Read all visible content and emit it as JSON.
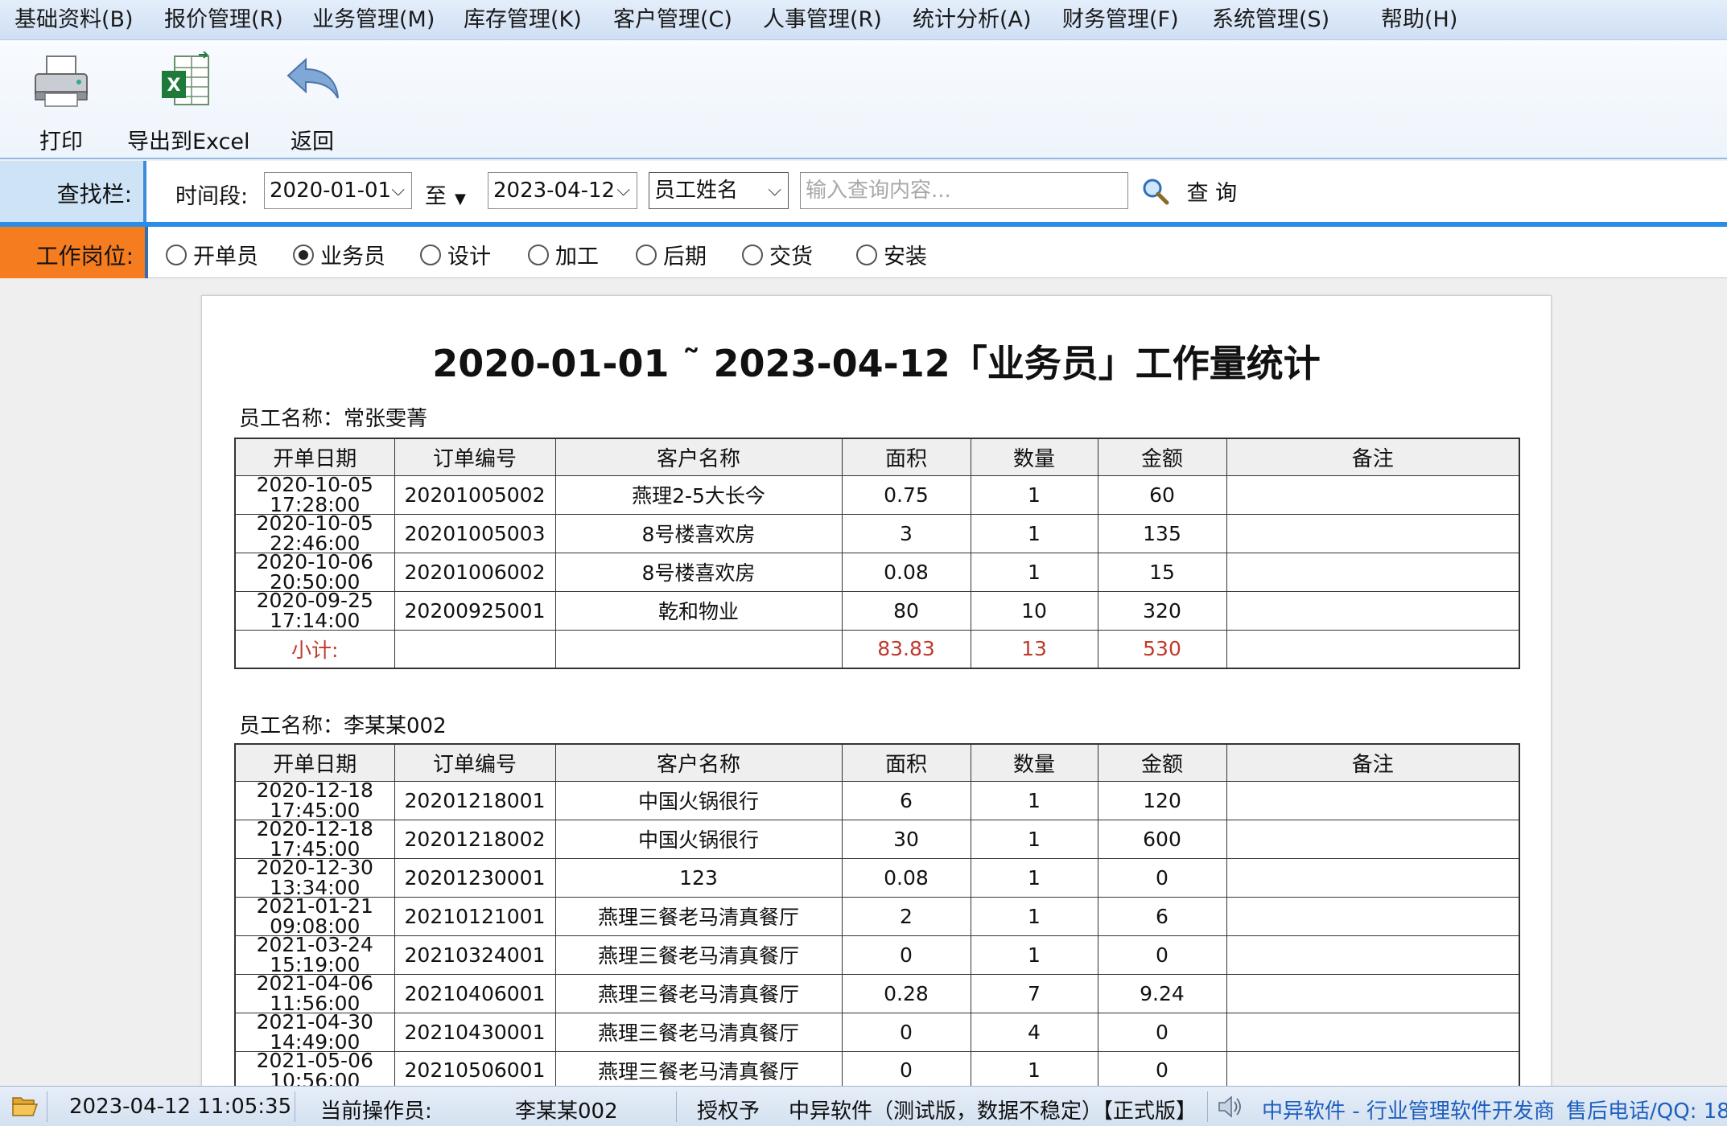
{
  "menu": [
    "基础资料(B)",
    "报价管理(R)",
    "业务管理(M)",
    "库存管理(K)",
    "客户管理(C)",
    "人事管理(R)",
    "统计分析(A)",
    "财务管理(F)",
    "系统管理(S)",
    "帮助(H)"
  ],
  "toolbar": {
    "print_label": "打印",
    "print_icon": "printer-icon",
    "export_label": "导出到Excel",
    "export_icon": "excel-export-icon",
    "back_label": "返回",
    "back_icon": "undo-arrow-icon"
  },
  "search": {
    "bar_label": "查找栏:",
    "period_label": "时间段:",
    "date_from": "2020-01-01",
    "to_label": "至",
    "date_to": "2023-04-12",
    "field_select": "员工姓名",
    "query_placeholder": "输入查询内容...",
    "query_label": "查 询"
  },
  "positions": {
    "label": "工作岗位:",
    "options": [
      "开单员",
      "业务员",
      "设计",
      "加工",
      "后期",
      "交货",
      "安装"
    ],
    "selected": "业务员"
  },
  "report": {
    "title": "2020-01-01 ˜ 2023-04-12「业务员」工作量统计",
    "columns": [
      "开单日期",
      "订单编号",
      "客户名称",
      "面积",
      "数量",
      "金额",
      "备注"
    ],
    "groups": [
      {
        "employee_label": "员工名称：常张雯菁",
        "rows": [
          {
            "date": "2020-10-05",
            "time": "17:28:00",
            "order": "20201005002",
            "customer": "燕理2-5大长今",
            "area": "0.75",
            "qty": "1",
            "amount": "60",
            "note": ""
          },
          {
            "date": "2020-10-05",
            "time": "22:46:00",
            "order": "20201005003",
            "customer": "8号楼喜欢房",
            "area": "3",
            "qty": "1",
            "amount": "135",
            "note": ""
          },
          {
            "date": "2020-10-06",
            "time": "20:50:00",
            "order": "20201006002",
            "customer": "8号楼喜欢房",
            "area": "0.08",
            "qty": "1",
            "amount": "15",
            "note": ""
          },
          {
            "date": "2020-09-25",
            "time": "17:14:00",
            "order": "20200925001",
            "customer": "乾和物业",
            "area": "80",
            "qty": "10",
            "amount": "320",
            "note": ""
          }
        ],
        "subtotal": {
          "label": "小计:",
          "area": "83.83",
          "qty": "13",
          "amount": "530"
        }
      },
      {
        "employee_label": "员工名称：李某某002",
        "rows": [
          {
            "date": "2020-12-18",
            "time": "17:45:00",
            "order": "20201218001",
            "customer": "中国火锅很行",
            "area": "6",
            "qty": "1",
            "amount": "120",
            "note": ""
          },
          {
            "date": "2020-12-18",
            "time": "17:45:00",
            "order": "20201218002",
            "customer": "中国火锅很行",
            "area": "30",
            "qty": "1",
            "amount": "600",
            "note": ""
          },
          {
            "date": "2020-12-30",
            "time": "13:34:00",
            "order": "20201230001",
            "customer": "123",
            "area": "0.08",
            "qty": "1",
            "amount": "0",
            "note": ""
          },
          {
            "date": "2021-01-21",
            "time": "09:08:00",
            "order": "20210121001",
            "customer": "燕理三餐老马清真餐厅",
            "area": "2",
            "qty": "1",
            "amount": "6",
            "note": ""
          },
          {
            "date": "2021-03-24",
            "time": "15:19:00",
            "order": "20210324001",
            "customer": "燕理三餐老马清真餐厅",
            "area": "0",
            "qty": "1",
            "amount": "0",
            "note": ""
          },
          {
            "date": "2021-04-06",
            "time": "11:56:00",
            "order": "20210406001",
            "customer": "燕理三餐老马清真餐厅",
            "area": "0.28",
            "qty": "7",
            "amount": "9.24",
            "note": ""
          },
          {
            "date": "2021-04-30",
            "time": "14:49:00",
            "order": "20210430001",
            "customer": "燕理三餐老马清真餐厅",
            "area": "0",
            "qty": "4",
            "amount": "0",
            "note": ""
          },
          {
            "date": "2021-05-06",
            "time": "10:56:00",
            "order": "20210506001",
            "customer": "燕理三餐老马清真餐厅",
            "area": "0",
            "qty": "1",
            "amount": "0",
            "note": ""
          }
        ]
      }
    ]
  },
  "status": {
    "folder_icon": "folder-open-icon",
    "datetime": "2023-04-12 11:05:35",
    "operator_label": "当前操作员:",
    "operator": "李某某002",
    "license": "授权予",
    "product": "中异软件（测试版，数据不稳定）【正式版】",
    "speaker_icon": "speaker-icon",
    "vendor": "中异软件 - 行业管理软件开发商",
    "support": "售后电话/QQ: 18"
  },
  "colors": {
    "accent_blue": "#2a8ee8",
    "position_label_bg": "#f57c1f",
    "subtotal_red": "#c0392b",
    "vendor_blue": "#1f5fbf"
  }
}
